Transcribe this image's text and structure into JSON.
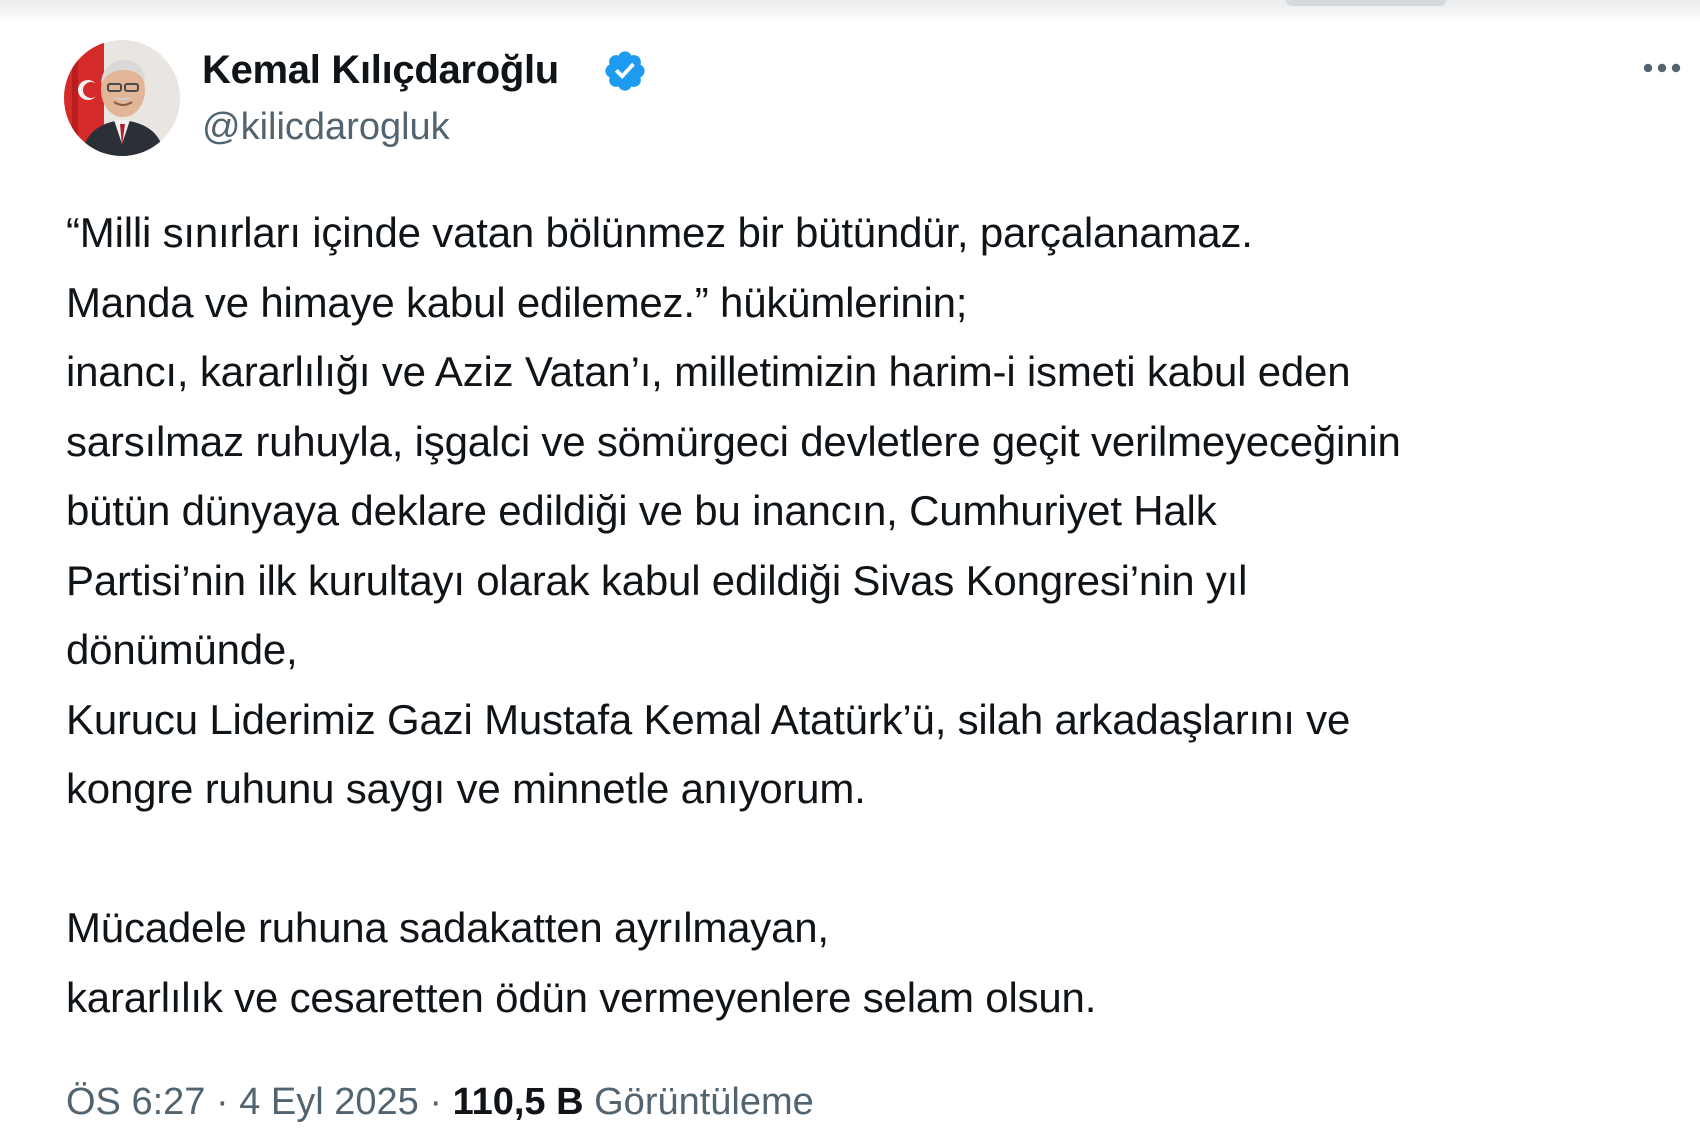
{
  "author": {
    "display_name": "Kemal Kılıçdaroğlu",
    "handle": "@kilicdarogluk",
    "verified": true,
    "verified_color": "#1d9bf0"
  },
  "tweet": {
    "lines": [
      "“Milli sınırları içinde vatan bölünmez bir bütündür, parçalanamaz.",
      "Manda ve himaye kabul edilemez.” hükümlerinin;",
      "inancı, kararlılığı ve Aziz Vatan’ı, milletimizin harim-i ismeti kabul eden",
      "sarsılmaz ruhuyla, işgalci ve sömürgeci devletlere geçit verilmeyeceğinin",
      "bütün dünyaya deklare edildiği ve bu inancın, Cumhuriyet Halk",
      "Partisi’nin ilk kurultayı olarak kabul edildiği Sivas Kongresi’nin yıl",
      "dönümünde,",
      "Kurucu Liderimiz Gazi Mustafa Kemal Atatürk’ü, silah arkadaşlarını ve",
      "kongre ruhunu saygı ve minnetle anıyorum.",
      "",
      "Mücadele ruhuna sadakatten ayrılmayan,",
      "kararlılık ve cesaretten ödün vermeyenlere selam olsun."
    ]
  },
  "meta": {
    "time": "ÖS 6:27",
    "separator": " · ",
    "date": "4 Eyl 2025",
    "views_count": "110,5 B",
    "views_label": "Görüntüleme"
  },
  "icons": {
    "more": "more-horizontal-icon",
    "verified": "verified-badge-icon"
  },
  "colors": {
    "text_primary": "#0f1419",
    "text_secondary": "#536471",
    "accent": "#1d9bf0"
  }
}
